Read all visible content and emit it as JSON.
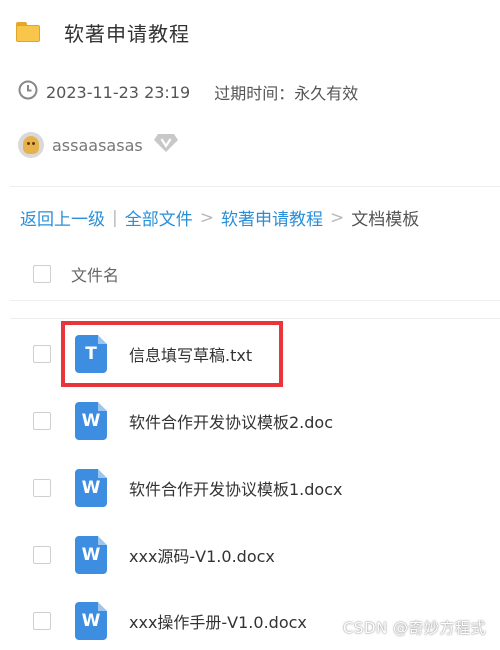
{
  "share": {
    "title": "软著申请教程",
    "date": "2023-11-23 23:19",
    "expire_label": "过期时间：",
    "expire_value": "永久有效",
    "username": "assaasasas"
  },
  "breadcrumb": {
    "back": "返回上一级",
    "sep1": "|",
    "all_files": "全部文件",
    "sep2": ">",
    "level1": "软著申请教程",
    "sep3": ">",
    "current": "文档模板"
  },
  "list": {
    "column_filename": "文件名",
    "files": [
      {
        "name": "信息填写草稿.txt",
        "type": "txt",
        "icon_letter": "T"
      },
      {
        "name": "软件合作开发协议模板2.doc",
        "type": "doc",
        "icon_letter": "W"
      },
      {
        "name": "软件合作开发协议模板1.docx",
        "type": "docx",
        "icon_letter": "W"
      },
      {
        "name": "xxx源码-V1.0.docx",
        "type": "docx",
        "icon_letter": "W"
      },
      {
        "name": "xxx操作手册-V1.0.docx",
        "type": "docx",
        "icon_letter": "W"
      }
    ]
  },
  "watermark": "CSDN @奇妙方程式",
  "icons": {
    "folder": "folder-icon",
    "clock": "clock-icon",
    "vip": "vip-diamond-icon",
    "txt": "txt-file-icon",
    "word": "word-file-icon"
  },
  "colors": {
    "link": "#2a8fd8",
    "file_icon": "#3d8de0",
    "highlight": "#e8343a",
    "folder": "#f7c64a"
  }
}
